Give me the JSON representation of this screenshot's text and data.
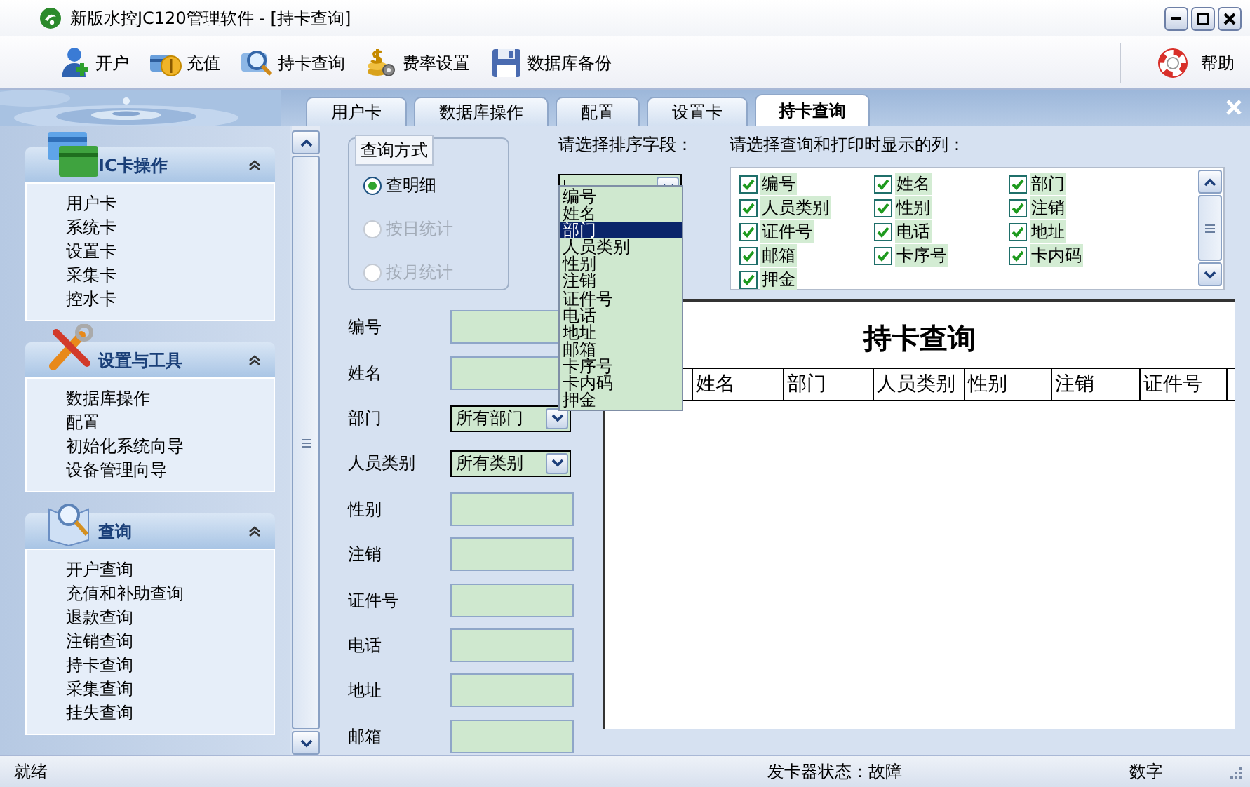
{
  "window": {
    "title": "新版水控JC120管理软件 - [持卡查询]"
  },
  "toolbar": [
    {
      "label": "开户"
    },
    {
      "label": "充值"
    },
    {
      "label": "持卡查询"
    },
    {
      "label": "费率设置"
    },
    {
      "label": "数据库备份"
    }
  ],
  "help": {
    "label": "帮助"
  },
  "tabs": [
    {
      "label": "用户卡",
      "selected": false
    },
    {
      "label": "数据库操作",
      "selected": false
    },
    {
      "label": "配置",
      "selected": false
    },
    {
      "label": "设置卡",
      "selected": false
    },
    {
      "label": "持卡查询",
      "selected": true
    }
  ],
  "sidebar": {
    "panels": [
      {
        "title": "IC卡操作",
        "expanded": true,
        "items": [
          "用户卡",
          "系统卡",
          "设置卡",
          "采集卡",
          "控水卡"
        ]
      },
      {
        "title": "设置与工具",
        "expanded": true,
        "items": [
          "数据库操作",
          "配置",
          "初始化系统向导",
          "设备管理向导"
        ]
      },
      {
        "title": "查询",
        "expanded": true,
        "items": [
          "开户查询",
          "充值和补助查询",
          "退款查询",
          "注销查询",
          "持卡查询",
          "采集查询",
          "挂失查询"
        ]
      }
    ]
  },
  "query_mode": {
    "legend": "查询方式",
    "options": [
      {
        "label": "查明细",
        "selected": true,
        "disabled": false
      },
      {
        "label": "按日统计",
        "selected": false,
        "disabled": true
      },
      {
        "label": "按月统计",
        "selected": false,
        "disabled": true
      }
    ]
  },
  "fields": [
    {
      "label": "编号",
      "kind": "text"
    },
    {
      "label": "姓名",
      "kind": "text"
    },
    {
      "label": "部门",
      "kind": "select",
      "value": "所有部门"
    },
    {
      "label": "人员类别",
      "kind": "select",
      "value": "所有类别"
    },
    {
      "label": "性别",
      "kind": "text"
    },
    {
      "label": "注销",
      "kind": "text"
    },
    {
      "label": "证件号",
      "kind": "text"
    },
    {
      "label": "电话",
      "kind": "text"
    },
    {
      "label": "地址",
      "kind": "text"
    },
    {
      "label": "邮箱",
      "kind": "text"
    }
  ],
  "sort": {
    "label": "请选择排序字段：",
    "expanded": true,
    "options": [
      {
        "label": "编号",
        "selected": false
      },
      {
        "label": "姓名",
        "selected": false
      },
      {
        "label": "部门",
        "selected": true
      },
      {
        "label": "人员类别",
        "selected": false
      },
      {
        "label": "性别",
        "selected": false
      },
      {
        "label": "注销",
        "selected": false
      },
      {
        "label": "证件号",
        "selected": false
      },
      {
        "label": "电话",
        "selected": false
      },
      {
        "label": "地址",
        "selected": false
      },
      {
        "label": "邮箱",
        "selected": false
      },
      {
        "label": "卡序号",
        "selected": false
      },
      {
        "label": "卡内码",
        "selected": false
      },
      {
        "label": "押金",
        "selected": false
      }
    ]
  },
  "columns_picker": {
    "label": "请选择查询和打印时显示的列：",
    "items": [
      {
        "label": "编号",
        "checked": true
      },
      {
        "label": "姓名",
        "checked": true
      },
      {
        "label": "部门",
        "checked": true
      },
      {
        "label": "人员类别",
        "checked": true
      },
      {
        "label": "性别",
        "checked": true
      },
      {
        "label": "注销",
        "checked": true
      },
      {
        "label": "证件号",
        "checked": true
      },
      {
        "label": "电话",
        "checked": true
      },
      {
        "label": "地址",
        "checked": true
      },
      {
        "label": "邮箱",
        "checked": true
      },
      {
        "label": "卡序号",
        "checked": true
      },
      {
        "label": "卡内码",
        "checked": true
      },
      {
        "label": "押金",
        "checked": true
      }
    ]
  },
  "report": {
    "title": "持卡查询",
    "columns": [
      "姓名",
      "部门",
      "人员类别",
      "性别",
      "注销",
      "证件号"
    ]
  },
  "status_bar": {
    "left": "就绪",
    "middle": "发卡器状态：故障",
    "right": "数字"
  }
}
